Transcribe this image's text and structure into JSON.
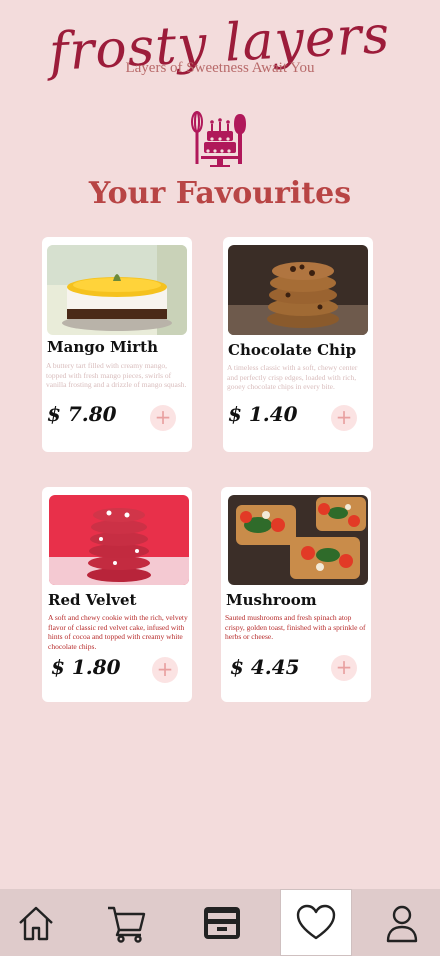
{
  "brand": {
    "title": "frosty layers",
    "tagline": "Layers of Sweetness Await You",
    "logo_icon": "whisk-cake-spatula-icon"
  },
  "page": {
    "title": "Your Favourites"
  },
  "cards": [
    {
      "name": "Mango Mirth",
      "description": "A buttery tart filled with creamy mango, topped with fresh mango pieces, swirls of vanilla frosting and a drizzle of mango squash.",
      "price": "$ 7.80",
      "add_label": "+",
      "image": "mango-cake-image"
    },
    {
      "name": "Chocolate Chip",
      "description": "A timeless classic with a soft, chewy center and perfectly crisp edges, loaded with rich, gooey chocolate chips in every bite.",
      "price": "$ 1.40",
      "add_label": "+",
      "image": "chocolate-chip-cookie-image"
    },
    {
      "name": "Red Velvet",
      "description": "A soft and chewy cookie with the rich, velvety flavor of classic red velvet cake, infused with hints of cocoa and topped with creamy white chocolate chips.",
      "price": "$ 1.80",
      "add_label": "+",
      "image": "red-velvet-cookie-image"
    },
    {
      "name": "Mushroom",
      "description": "Sauted mushrooms and fresh spinach atop crispy, golden toast, finished with a sprinkle of herbs or cheese.",
      "price": "$ 4.45",
      "add_label": "+",
      "image": "mushroom-toast-image"
    }
  ],
  "navbar": {
    "items": [
      {
        "icon": "home-icon",
        "active": false
      },
      {
        "icon": "cart-icon",
        "active": false
      },
      {
        "icon": "orders-box-icon",
        "active": false
      },
      {
        "icon": "heart-icon",
        "active": true
      },
      {
        "icon": "user-icon",
        "active": false
      }
    ]
  },
  "colors": {
    "background": "#f3dcdc",
    "brand": "#9c1c3a",
    "heading": "#b84545",
    "navbar": "#dfcbcb"
  }
}
